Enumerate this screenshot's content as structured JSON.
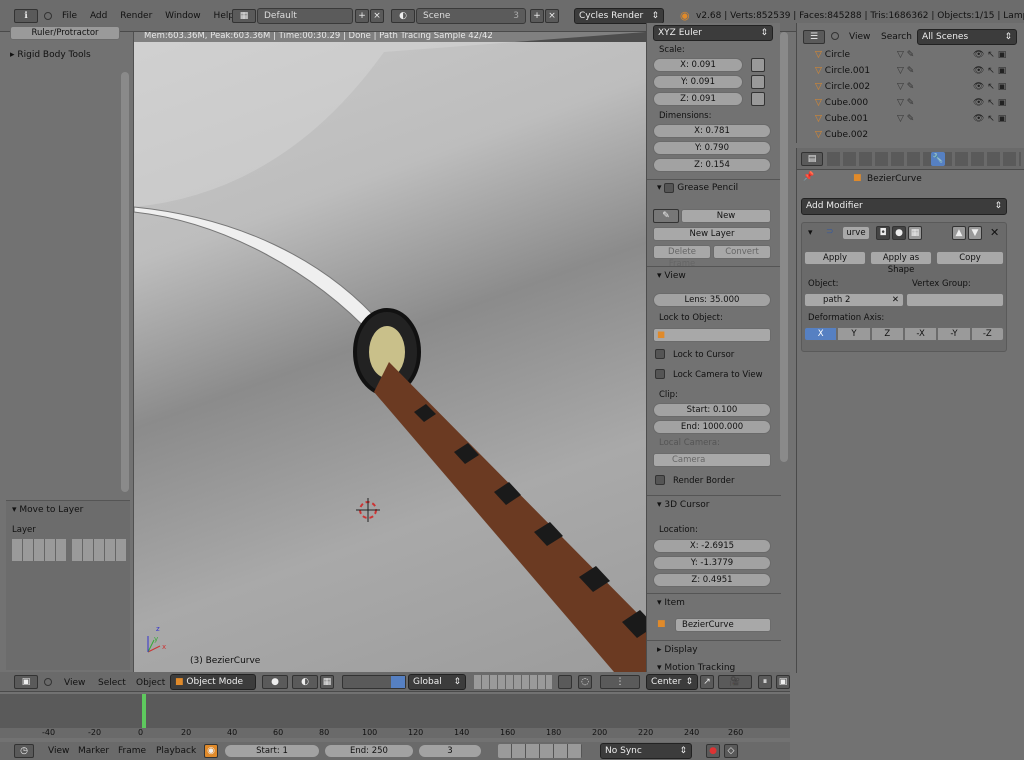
{
  "topbar": {
    "menus": [
      "File",
      "Add",
      "Render",
      "Window",
      "Help"
    ],
    "layout": "Default",
    "scene": "Scene",
    "scene_users": "3",
    "engine": "Cycles Render",
    "stats": "v2.68 | Verts:852539 | Faces:845288 | Tris:1686362 | Objects:1/15 | Lamps:0/"
  },
  "left": {
    "ruler_label": "Ruler/Protractor",
    "rigid": "Rigid Body Tools",
    "move_layer": "Move to Layer",
    "layer": "Layer"
  },
  "viewport": {
    "status": "Mem:603.36M, Peak:603.36M | Time:00:30.29 | Done | Path Tracing Sample 42/42",
    "object": "(3) BezierCurve",
    "axis_x": "x",
    "axis_y": "y",
    "axis_z": "z"
  },
  "rpanel": {
    "rot_mode": "XYZ Euler",
    "scale_label": "Scale:",
    "scale": [
      "X: 0.091",
      "Y: 0.091",
      "Z: 0.091"
    ],
    "dim_label": "Dimensions:",
    "dims": [
      "X: 0.781",
      "Y: 0.790",
      "Z: 0.154"
    ],
    "grease": "Grease Pencil",
    "gp_new": "New",
    "gp_new_layer": "New Layer",
    "gp_delete": "Delete Frame",
    "gp_convert": "Convert",
    "view": "View",
    "lens": "Lens: 35.000",
    "lock_obj": "Lock to Object:",
    "lock_cursor": "Lock to Cursor",
    "lock_cam": "Lock Camera to View",
    "clip": "Clip:",
    "clip_start": "Start: 0.100",
    "clip_end": "End: 1000.000",
    "local_cam": "Local Camera:",
    "camera": "Camera",
    "render_border": "Render Border",
    "cursor": "3D Cursor",
    "location": "Location:",
    "loc": [
      "X: -2.6915",
      "Y: -1.3779",
      "Z: 0.4951"
    ],
    "item": "Item",
    "item_name": "BezierCurve",
    "display": "Display",
    "motion": "Motion Tracking"
  },
  "outliner": {
    "view": "View",
    "search": "Search",
    "filter": "All Scenes",
    "items": [
      "Circle",
      "Circle.001",
      "Circle.002",
      "Cube.000",
      "Cube.001",
      "Cube.002"
    ]
  },
  "props": {
    "context": "BezierCurve",
    "add_mod": "Add Modifier",
    "mod_name": "urve",
    "apply": "Apply",
    "apply_shape": "Apply as Shape",
    "copy": "Copy",
    "object_lbl": "Object:",
    "vgroup_lbl": "Vertex Group:",
    "object_val": "path 2",
    "deform_lbl": "Deformation Axis:",
    "axes": [
      "X",
      "Y",
      "Z",
      "-X",
      "-Y",
      "-Z"
    ]
  },
  "toolbar3d": {
    "view": "View",
    "select": "Select",
    "object": "Object",
    "mode": "Object Mode",
    "orient": "Global",
    "pivot": "Center"
  },
  "timeline": {
    "ticks": [
      "-40",
      "-20",
      "0",
      "20",
      "40",
      "60",
      "80",
      "100",
      "120",
      "140",
      "160",
      "180",
      "200",
      "220",
      "240",
      "260"
    ],
    "view": "View",
    "marker": "Marker",
    "frame": "Frame",
    "playback": "Playback",
    "start": "Start: 1",
    "end": "End: 250",
    "current": "3",
    "sync": "No Sync"
  },
  "colors": {
    "accent": "#5680c2",
    "handle": "#6b3a22",
    "timeline_cursor": "#5ec95e"
  }
}
